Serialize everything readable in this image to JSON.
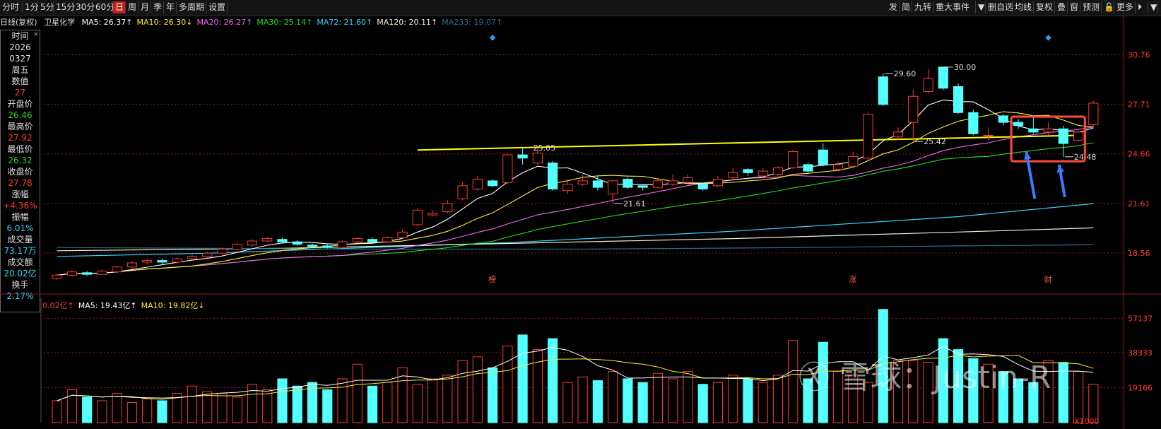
{
  "toolbar": {
    "left": [
      "分时",
      "1分",
      "5分",
      "15分",
      "30分",
      "60分",
      "日",
      "周",
      "月",
      "季",
      "年",
      "多周期",
      "设置"
    ],
    "active": "日",
    "right": [
      "发",
      "简",
      "九转",
      "重大事件",
      "▼",
      "删自选",
      "均线",
      "复权",
      "叠",
      "窗",
      "预测",
      "🔓",
      "更多",
      "⏵",
      "▼"
    ]
  },
  "info": {
    "period": "日线(复权)",
    "stock": "卫星化学",
    "ma": [
      {
        "label": "MA5: 26.37↑",
        "color": "#ffffff"
      },
      {
        "label": "MA10: 26.30↓",
        "color": "#ffee33"
      },
      {
        "label": "MA20: 26.27↑",
        "color": "#ee66ee"
      },
      {
        "label": "MA30: 25.14↑",
        "color": "#22dd22"
      },
      {
        "label": "MA72: 21.60↑",
        "color": "#33d6ff"
      },
      {
        "label": "MA120: 20.11↑",
        "color": "#f2f2d0"
      },
      {
        "label": "MA233: 19.07↑",
        "color": "#2f6f8f"
      }
    ]
  },
  "side": [
    {
      "t": "时间",
      "c": "lbl"
    },
    {
      "t": "2026",
      "c": "wht"
    },
    {
      "t": "0327",
      "c": "wht"
    },
    {
      "t": "周五",
      "c": "wht"
    },
    {
      "t": "数值",
      "c": "lbl"
    },
    {
      "t": "27",
      "c": "red"
    },
    {
      "t": "开盘价",
      "c": "lbl"
    },
    {
      "t": "26.46",
      "c": "grn"
    },
    {
      "t": "最高价",
      "c": "lbl"
    },
    {
      "t": "27.92",
      "c": "red"
    },
    {
      "t": "最低价",
      "c": "lbl"
    },
    {
      "t": "26.32",
      "c": "grn"
    },
    {
      "t": "收盘价",
      "c": "lbl"
    },
    {
      "t": "27.78",
      "c": "red"
    },
    {
      "t": "涨幅",
      "c": "lbl"
    },
    {
      "t": "+4.36%",
      "c": "red"
    },
    {
      "t": "振幅",
      "c": "lbl"
    },
    {
      "t": "6.01%",
      "c": "cyan"
    },
    {
      "t": "成交量",
      "c": "lbl"
    },
    {
      "t": "73.17万",
      "c": "cyan"
    },
    {
      "t": "成交额",
      "c": "lbl"
    },
    {
      "t": "20.02亿",
      "c": "cyan"
    },
    {
      "t": "换手",
      "c": "lbl"
    },
    {
      "t": "2.17%",
      "c": "cyan"
    }
  ],
  "side_close": "×",
  "volume_info": [
    {
      "label": "0.02亿↑",
      "color": "#ff3b30"
    },
    {
      "label": "MA5: 19.43亿↑",
      "color": "#ffffff"
    },
    {
      "label": "MA10: 19.82亿↓",
      "color": "#ffee33"
    }
  ],
  "watermark": "Ⓧ 雪球：Justin-R",
  "unit": "X1000",
  "chart_data": {
    "type": "candlestick",
    "price_axis": {
      "ticks": [
        30.76,
        27.71,
        24.66,
        21.61,
        18.56
      ],
      "ylim": [
        16.3,
        32.3
      ]
    },
    "volume_axis": {
      "ticks": [
        57137,
        38333,
        19166
      ],
      "ylim": [
        0,
        65000
      ]
    },
    "candles": [
      [
        17.0,
        17.2,
        17.3,
        16.9
      ],
      [
        17.2,
        17.4,
        17.5,
        17.1
      ],
      [
        17.35,
        17.25,
        17.45,
        17.15
      ],
      [
        17.25,
        17.45,
        17.55,
        17.2
      ],
      [
        17.4,
        17.7,
        17.8,
        17.35
      ],
      [
        17.7,
        17.95,
        18.05,
        17.6
      ],
      [
        18.0,
        18.1,
        18.2,
        17.85
      ],
      [
        18.1,
        18.0,
        18.2,
        17.9
      ],
      [
        18.0,
        18.2,
        18.3,
        17.9
      ],
      [
        18.2,
        18.35,
        18.45,
        18.1
      ],
      [
        18.35,
        18.55,
        18.65,
        18.25
      ],
      [
        18.55,
        18.8,
        18.9,
        18.45
      ],
      [
        18.8,
        19.1,
        19.25,
        18.7
      ],
      [
        19.05,
        19.3,
        19.4,
        18.95
      ],
      [
        19.3,
        19.45,
        19.55,
        19.2
      ],
      [
        19.4,
        19.25,
        19.5,
        19.15
      ],
      [
        19.25,
        19.1,
        19.35,
        19.0
      ],
      [
        19.05,
        18.95,
        19.15,
        18.9
      ],
      [
        19.0,
        18.9,
        19.15,
        18.85
      ],
      [
        18.9,
        19.25,
        19.35,
        18.85
      ],
      [
        19.25,
        19.45,
        19.55,
        19.2
      ],
      [
        19.4,
        19.25,
        19.5,
        19.2
      ],
      [
        19.25,
        19.5,
        19.6,
        19.2
      ],
      [
        19.5,
        19.85,
        20.0,
        19.45
      ],
      [
        20.3,
        21.2,
        21.3,
        20.2
      ],
      [
        20.9,
        21.0,
        21.2,
        20.8
      ],
      [
        21.1,
        21.6,
        21.8,
        21.0
      ],
      [
        21.9,
        22.7,
        22.9,
        21.8
      ],
      [
        22.5,
        23.1,
        23.3,
        22.4
      ],
      [
        23.0,
        22.7,
        23.1,
        22.6
      ],
      [
        22.9,
        24.6,
        24.7,
        22.8
      ],
      [
        24.6,
        24.4,
        25.05,
        24.0
      ],
      [
        24.1,
        24.7,
        25.0,
        24.0
      ],
      [
        24.1,
        22.5,
        24.2,
        22.4
      ],
      [
        22.4,
        22.8,
        23.1,
        22.2
      ],
      [
        22.8,
        23.0,
        23.4,
        22.7
      ],
      [
        23.0,
        22.6,
        23.3,
        22.4
      ],
      [
        22.2,
        23.0,
        23.1,
        21.61
      ],
      [
        23.1,
        22.6,
        23.2,
        22.5
      ],
      [
        22.7,
        22.6,
        22.8,
        22.4
      ],
      [
        22.6,
        23.0,
        23.1,
        22.5
      ],
      [
        22.8,
        23.0,
        23.4,
        22.7
      ],
      [
        22.9,
        23.2,
        23.4,
        22.8
      ],
      [
        22.8,
        22.5,
        22.9,
        22.4
      ],
      [
        22.7,
        23.1,
        23.3,
        22.6
      ],
      [
        23.2,
        23.5,
        23.8,
        23.0
      ],
      [
        23.7,
        23.5,
        23.8,
        23.3
      ],
      [
        23.3,
        23.6,
        23.8,
        23.2
      ],
      [
        23.4,
        23.8,
        23.9,
        23.3
      ],
      [
        23.8,
        24.8,
        24.9,
        23.7
      ],
      [
        24.0,
        23.6,
        24.1,
        23.5
      ],
      [
        24.9,
        24.0,
        25.3,
        23.9
      ],
      [
        23.7,
        24.0,
        24.2,
        23.6
      ],
      [
        23.9,
        24.5,
        24.8,
        23.8
      ],
      [
        24.4,
        27.1,
        27.2,
        24.3
      ],
      [
        29.4,
        27.7,
        29.6,
        27.6
      ],
      [
        25.7,
        26.0,
        26.3,
        25.5
      ],
      [
        26.6,
        28.2,
        28.6,
        25.42
      ],
      [
        28.5,
        29.3,
        29.9,
        28.4
      ],
      [
        30.0,
        28.7,
        30.0,
        28.6
      ],
      [
        28.8,
        27.2,
        29.0,
        27.1
      ],
      [
        27.2,
        25.9,
        27.4,
        25.8
      ],
      [
        25.8,
        25.8,
        26.3,
        25.5
      ],
      [
        27.0,
        26.6,
        27.1,
        26.4
      ],
      [
        26.6,
        26.4,
        26.8,
        26.2
      ],
      [
        26.2,
        26.0,
        26.9,
        25.9
      ],
      [
        26.0,
        26.2,
        26.6,
        25.8
      ],
      [
        26.2,
        25.3,
        26.4,
        24.48
      ],
      [
        25.5,
        26.0,
        26.1,
        25.4
      ],
      [
        26.46,
        27.78,
        27.92,
        26.32
      ]
    ],
    "volume": [
      12,
      18,
      14,
      12,
      16,
      11,
      13,
      12,
      16,
      20,
      17,
      16,
      14,
      21,
      18,
      24,
      20,
      22,
      18,
      24,
      32,
      20,
      22,
      30,
      21,
      24,
      26,
      34,
      36,
      30,
      42,
      48,
      40,
      46,
      22,
      25,
      23,
      28,
      24,
      22,
      27,
      24,
      28,
      21,
      22,
      26,
      24,
      22,
      26,
      45,
      24,
      44,
      28,
      26,
      22,
      62,
      34,
      34,
      33,
      46,
      40,
      35,
      32,
      28,
      24,
      22,
      34,
      33,
      28,
      21
    ],
    "annotations": [
      {
        "label": "25.05",
        "idx": 31,
        "price": 25.05,
        "dir": "right"
      },
      {
        "label": "21.61",
        "idx": 37,
        "price": 21.61,
        "dir": "right"
      },
      {
        "label": "29.60",
        "idx": 55,
        "price": 29.6,
        "dir": "right"
      },
      {
        "label": "25.42",
        "idx": 57,
        "price": 25.42,
        "dir": "right"
      },
      {
        "label": "30.00",
        "idx": 59,
        "price": 30.0,
        "dir": "right"
      },
      {
        "label": "24.48",
        "idx": 67,
        "price": 24.48,
        "dir": "right"
      }
    ],
    "event_labels": [
      {
        "label": "榜",
        "idx": 29
      },
      {
        "label": "涨",
        "idx": 53
      },
      {
        "label": "财",
        "idx": 66
      }
    ],
    "ma_overlays": [
      {
        "name": "MA72",
        "color": "#33d6ff",
        "points": [
          [
            0,
            18.35
          ],
          [
            10,
            18.55
          ],
          [
            30,
            19.2
          ],
          [
            45,
            19.9
          ],
          [
            60,
            20.8
          ],
          [
            69,
            21.6
          ]
        ]
      },
      {
        "name": "MA120",
        "color": "#f2f2d0",
        "points": [
          [
            0,
            18.7
          ],
          [
            15,
            18.85
          ],
          [
            30,
            19.15
          ],
          [
            45,
            19.45
          ],
          [
            60,
            19.85
          ],
          [
            69,
            20.11
          ]
        ]
      },
      {
        "name": "MA233",
        "color": "#2f6f8f",
        "points": [
          [
            0,
            18.9
          ],
          [
            20,
            18.8
          ],
          [
            35,
            18.8
          ],
          [
            50,
            18.9
          ],
          [
            60,
            19.0
          ],
          [
            69,
            19.07
          ]
        ]
      }
    ],
    "trendline": {
      "from": [
        24,
        24.9
      ],
      "to": [
        68,
        25.8
      ],
      "color": "#ffff00"
    }
  }
}
